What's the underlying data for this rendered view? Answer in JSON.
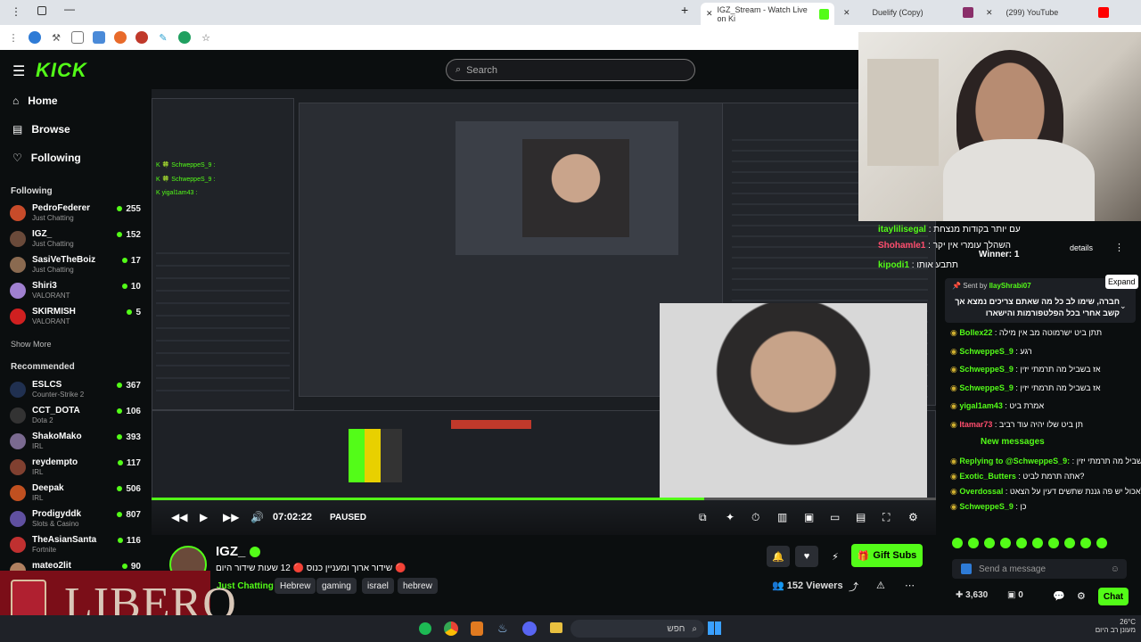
{
  "browser": {
    "tabs": [
      {
        "label": "IGZ_Stream - Watch Live on Ki",
        "active": true
      },
      {
        "label": "Duelify (Copy)",
        "active": false
      },
      {
        "label": "(299) YouTube",
        "active": false
      }
    ]
  },
  "kick": {
    "logo": "KICK",
    "search_placeholder": "Search",
    "nav": [
      {
        "icon": "home-icon",
        "label": "Home"
      },
      {
        "icon": "browse-icon",
        "label": "Browse"
      },
      {
        "icon": "heart-icon",
        "label": "Following"
      }
    ],
    "following_title": "Following",
    "following": [
      {
        "name": "PedroFederer",
        "category": "Just Chatting",
        "viewers": "255",
        "color": "#c74b2a"
      },
      {
        "name": "IGZ_",
        "category": "Just Chatting",
        "viewers": "152",
        "color": "#6a4a3a"
      },
      {
        "name": "SasiVeTheBoiz",
        "category": "Just Chatting",
        "viewers": "17",
        "color": "#8a6a50"
      },
      {
        "name": "Shiri3",
        "category": "VALORANT",
        "viewers": "10",
        "color": "#a080d0"
      },
      {
        "name": "SKIRMISH",
        "category": "VALORANT",
        "viewers": "5",
        "color": "#d02020"
      }
    ],
    "show_more": "Show More",
    "recommended_title": "Recommended",
    "recommended": [
      {
        "name": "ESLCS",
        "category": "Counter-Strike 2",
        "viewers": "367",
        "color": "#203050"
      },
      {
        "name": "CCT_DOTA",
        "category": "Dota 2",
        "viewers": "106",
        "color": "#333"
      },
      {
        "name": "ShakoMako",
        "category": "IRL",
        "viewers": "393",
        "color": "#7a6a90"
      },
      {
        "name": "reydempto",
        "category": "IRL",
        "viewers": "117",
        "color": "#804030"
      },
      {
        "name": "Deepak",
        "category": "IRL",
        "viewers": "506",
        "color": "#c05020"
      },
      {
        "name": "Prodigyddk",
        "category": "Slots & Casino",
        "viewers": "807",
        "color": "#6050a0"
      },
      {
        "name": "TheAsianSanta",
        "category": "Fortnite",
        "viewers": "116",
        "color": "#c03030"
      },
      {
        "name": "mateo2lit",
        "category": "",
        "viewers": "90",
        "color": "#b08060"
      }
    ]
  },
  "player": {
    "time": "07:02:22",
    "status": "PAUSED",
    "progress_fraction": 0.705
  },
  "stream": {
    "streamer": "IGZ_",
    "title": "שידור ארוך ומעניין כנוס 🔴 12 שעות שידור היום 🔴",
    "tags": [
      "Just Chatting",
      "Hebrew",
      "gaming",
      "israel",
      "hebrew"
    ],
    "viewers": "152 Viewers",
    "gift_subs": "Gift Subs"
  },
  "chat": {
    "overlay_top": [
      {
        "user": "itaylilisegal",
        "text": "עם יותר בקודות מנצחת"
      },
      {
        "user": "Shohamle1",
        "text": "השהלך עומרי אין יקר"
      },
      {
        "user": "kipodi1",
        "text": "תתבע אותו"
      }
    ],
    "details": "details",
    "winner": "Winner: 1",
    "expand": "Expand",
    "pinned_sender_prefix": "Sent by",
    "pinned_sender": "IlayShrabi07",
    "pinned_text": "חברה, שימו לב כל מה שאתם צריכים נמצא אך קשב אחרי בכל הפלטפורמות והישארו",
    "messages": [
      {
        "user": "Bollex22",
        "text": "תתן ביט ישרמוטה מב אין מילה"
      },
      {
        "user": "SchweppeS_9",
        "text": "רגע"
      },
      {
        "user": "SchweppeS_9",
        "text": "אז בשביל מה תרמתי יזין"
      },
      {
        "user": "SchweppeS_9",
        "text": "אז בשביל מה תרמתי יזין"
      },
      {
        "user": "yigal1am43",
        "text": "אמרת ביט"
      },
      {
        "user": "Itamar73",
        "text": "תן ביט שלו יהיה עוד רביב"
      }
    ],
    "new_messages": "New messages",
    "after_new": [
      {
        "user": "Replying to @SchweppeS_9:",
        "text": "אז בשביל מה תרמתי יזין"
      },
      {
        "user": "Exotic_Butters",
        "text": "אתה תרמת לביט?"
      },
      {
        "user": "Overdossal",
        "text": "הלכתי לאכול יש פה גננת שתשים דעין על הצאט?"
      },
      {
        "user": "SchweppeS_9",
        "text": "כן"
      }
    ],
    "input_placeholder": "Send a message",
    "points": "3,630",
    "zero": "0",
    "send_label": "Chat"
  },
  "ad": {
    "text": "LIBERO"
  },
  "taskbar": {
    "search": "חפש",
    "weather": "26°C",
    "weather_sub": "מעונן רב היום"
  }
}
